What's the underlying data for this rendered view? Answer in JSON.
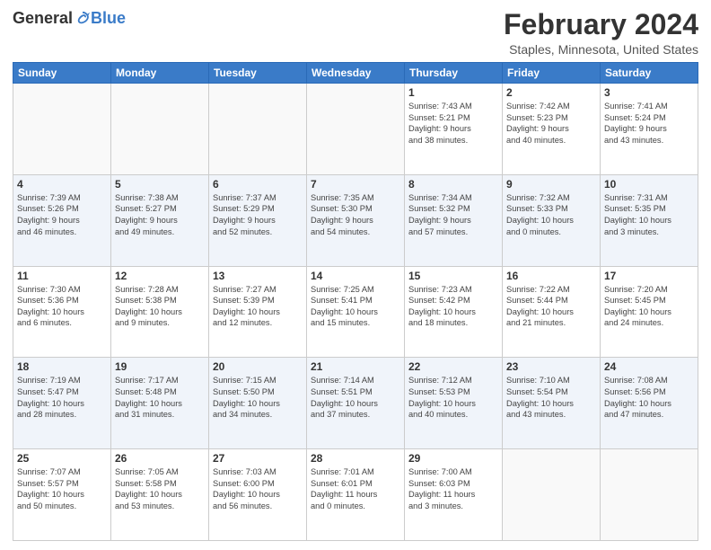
{
  "logo": {
    "general": "General",
    "blue": "Blue"
  },
  "header": {
    "title": "February 2024",
    "subtitle": "Staples, Minnesota, United States"
  },
  "weekdays": [
    "Sunday",
    "Monday",
    "Tuesday",
    "Wednesday",
    "Thursday",
    "Friday",
    "Saturday"
  ],
  "weeks": [
    [
      {
        "day": "",
        "info": ""
      },
      {
        "day": "",
        "info": ""
      },
      {
        "day": "",
        "info": ""
      },
      {
        "day": "",
        "info": ""
      },
      {
        "day": "1",
        "info": "Sunrise: 7:43 AM\nSunset: 5:21 PM\nDaylight: 9 hours\nand 38 minutes."
      },
      {
        "day": "2",
        "info": "Sunrise: 7:42 AM\nSunset: 5:23 PM\nDaylight: 9 hours\nand 40 minutes."
      },
      {
        "day": "3",
        "info": "Sunrise: 7:41 AM\nSunset: 5:24 PM\nDaylight: 9 hours\nand 43 minutes."
      }
    ],
    [
      {
        "day": "4",
        "info": "Sunrise: 7:39 AM\nSunset: 5:26 PM\nDaylight: 9 hours\nand 46 minutes."
      },
      {
        "day": "5",
        "info": "Sunrise: 7:38 AM\nSunset: 5:27 PM\nDaylight: 9 hours\nand 49 minutes."
      },
      {
        "day": "6",
        "info": "Sunrise: 7:37 AM\nSunset: 5:29 PM\nDaylight: 9 hours\nand 52 minutes."
      },
      {
        "day": "7",
        "info": "Sunrise: 7:35 AM\nSunset: 5:30 PM\nDaylight: 9 hours\nand 54 minutes."
      },
      {
        "day": "8",
        "info": "Sunrise: 7:34 AM\nSunset: 5:32 PM\nDaylight: 9 hours\nand 57 minutes."
      },
      {
        "day": "9",
        "info": "Sunrise: 7:32 AM\nSunset: 5:33 PM\nDaylight: 10 hours\nand 0 minutes."
      },
      {
        "day": "10",
        "info": "Sunrise: 7:31 AM\nSunset: 5:35 PM\nDaylight: 10 hours\nand 3 minutes."
      }
    ],
    [
      {
        "day": "11",
        "info": "Sunrise: 7:30 AM\nSunset: 5:36 PM\nDaylight: 10 hours\nand 6 minutes."
      },
      {
        "day": "12",
        "info": "Sunrise: 7:28 AM\nSunset: 5:38 PM\nDaylight: 10 hours\nand 9 minutes."
      },
      {
        "day": "13",
        "info": "Sunrise: 7:27 AM\nSunset: 5:39 PM\nDaylight: 10 hours\nand 12 minutes."
      },
      {
        "day": "14",
        "info": "Sunrise: 7:25 AM\nSunset: 5:41 PM\nDaylight: 10 hours\nand 15 minutes."
      },
      {
        "day": "15",
        "info": "Sunrise: 7:23 AM\nSunset: 5:42 PM\nDaylight: 10 hours\nand 18 minutes."
      },
      {
        "day": "16",
        "info": "Sunrise: 7:22 AM\nSunset: 5:44 PM\nDaylight: 10 hours\nand 21 minutes."
      },
      {
        "day": "17",
        "info": "Sunrise: 7:20 AM\nSunset: 5:45 PM\nDaylight: 10 hours\nand 24 minutes."
      }
    ],
    [
      {
        "day": "18",
        "info": "Sunrise: 7:19 AM\nSunset: 5:47 PM\nDaylight: 10 hours\nand 28 minutes."
      },
      {
        "day": "19",
        "info": "Sunrise: 7:17 AM\nSunset: 5:48 PM\nDaylight: 10 hours\nand 31 minutes."
      },
      {
        "day": "20",
        "info": "Sunrise: 7:15 AM\nSunset: 5:50 PM\nDaylight: 10 hours\nand 34 minutes."
      },
      {
        "day": "21",
        "info": "Sunrise: 7:14 AM\nSunset: 5:51 PM\nDaylight: 10 hours\nand 37 minutes."
      },
      {
        "day": "22",
        "info": "Sunrise: 7:12 AM\nSunset: 5:53 PM\nDaylight: 10 hours\nand 40 minutes."
      },
      {
        "day": "23",
        "info": "Sunrise: 7:10 AM\nSunset: 5:54 PM\nDaylight: 10 hours\nand 43 minutes."
      },
      {
        "day": "24",
        "info": "Sunrise: 7:08 AM\nSunset: 5:56 PM\nDaylight: 10 hours\nand 47 minutes."
      }
    ],
    [
      {
        "day": "25",
        "info": "Sunrise: 7:07 AM\nSunset: 5:57 PM\nDaylight: 10 hours\nand 50 minutes."
      },
      {
        "day": "26",
        "info": "Sunrise: 7:05 AM\nSunset: 5:58 PM\nDaylight: 10 hours\nand 53 minutes."
      },
      {
        "day": "27",
        "info": "Sunrise: 7:03 AM\nSunset: 6:00 PM\nDaylight: 10 hours\nand 56 minutes."
      },
      {
        "day": "28",
        "info": "Sunrise: 7:01 AM\nSunset: 6:01 PM\nDaylight: 11 hours\nand 0 minutes."
      },
      {
        "day": "29",
        "info": "Sunrise: 7:00 AM\nSunset: 6:03 PM\nDaylight: 11 hours\nand 3 minutes."
      },
      {
        "day": "",
        "info": ""
      },
      {
        "day": "",
        "info": ""
      }
    ]
  ]
}
